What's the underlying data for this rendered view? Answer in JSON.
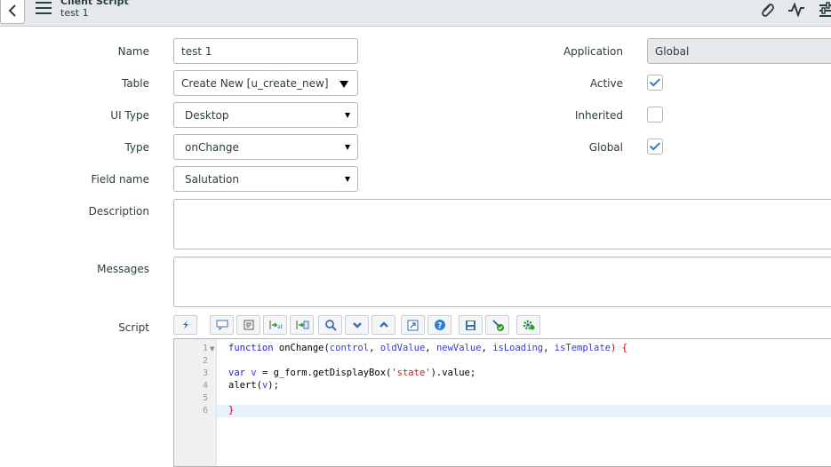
{
  "header": {
    "record_type": "Client Script",
    "record_name": "test 1",
    "icons": [
      "back-icon",
      "menu-icon",
      "attachment-icon",
      "activity-icon",
      "settings-icon"
    ]
  },
  "form": {
    "name": {
      "label": "Name",
      "value": "test 1"
    },
    "table": {
      "label": "Table",
      "value": "Create New [u_create_new]"
    },
    "ui_type": {
      "label": "UI Type",
      "value": "Desktop"
    },
    "type": {
      "label": "Type",
      "value": "onChange"
    },
    "field_name": {
      "label": "Field name",
      "value": "Salutation"
    },
    "description": {
      "label": "Description",
      "value": ""
    },
    "messages": {
      "label": "Messages",
      "value": ""
    },
    "application": {
      "label": "Application",
      "value": "Global"
    },
    "active": {
      "label": "Active",
      "checked": true
    },
    "inherited": {
      "label": "Inherited",
      "checked": false
    },
    "global": {
      "label": "Global",
      "checked": true
    },
    "script": {
      "label": "Script"
    }
  },
  "script_toolbar": [
    "toggle-syntax-icon",
    "comment-icon",
    "format-icon",
    "replace-icon",
    "replace-all-icon",
    "search-icon",
    "next-icon",
    "previous-icon",
    "fullscreen-icon",
    "help-icon",
    "save-icon",
    "script-check-icon",
    "debug-icon"
  ],
  "script": {
    "line_numbers": [
      "1",
      "2",
      "3",
      "4",
      "5",
      "6"
    ],
    "l1": {
      "kw": "function",
      "name": " onChange(",
      "p1": "control",
      "c1": ", ",
      "p2": "oldValue",
      "c2": ", ",
      "p3": "newValue",
      "c3": ", ",
      "p4": "isLoading",
      "c4": ", ",
      "p5": "isTemplate",
      "end": ") {"
    },
    "l3": {
      "kw": "var",
      "mid": " ",
      "var": "v",
      "rest": " = g_form.getDisplayBox(",
      "str": "'state'",
      "end": ").value;"
    },
    "l4": {
      "pre": "alert(",
      "var": "v",
      "end": ");"
    },
    "l6": "}"
  },
  "colors": {
    "header_bg": "#e6e9eb",
    "checkbox_blue": "#2e7ac2",
    "active_line": "#e8f2ff"
  }
}
